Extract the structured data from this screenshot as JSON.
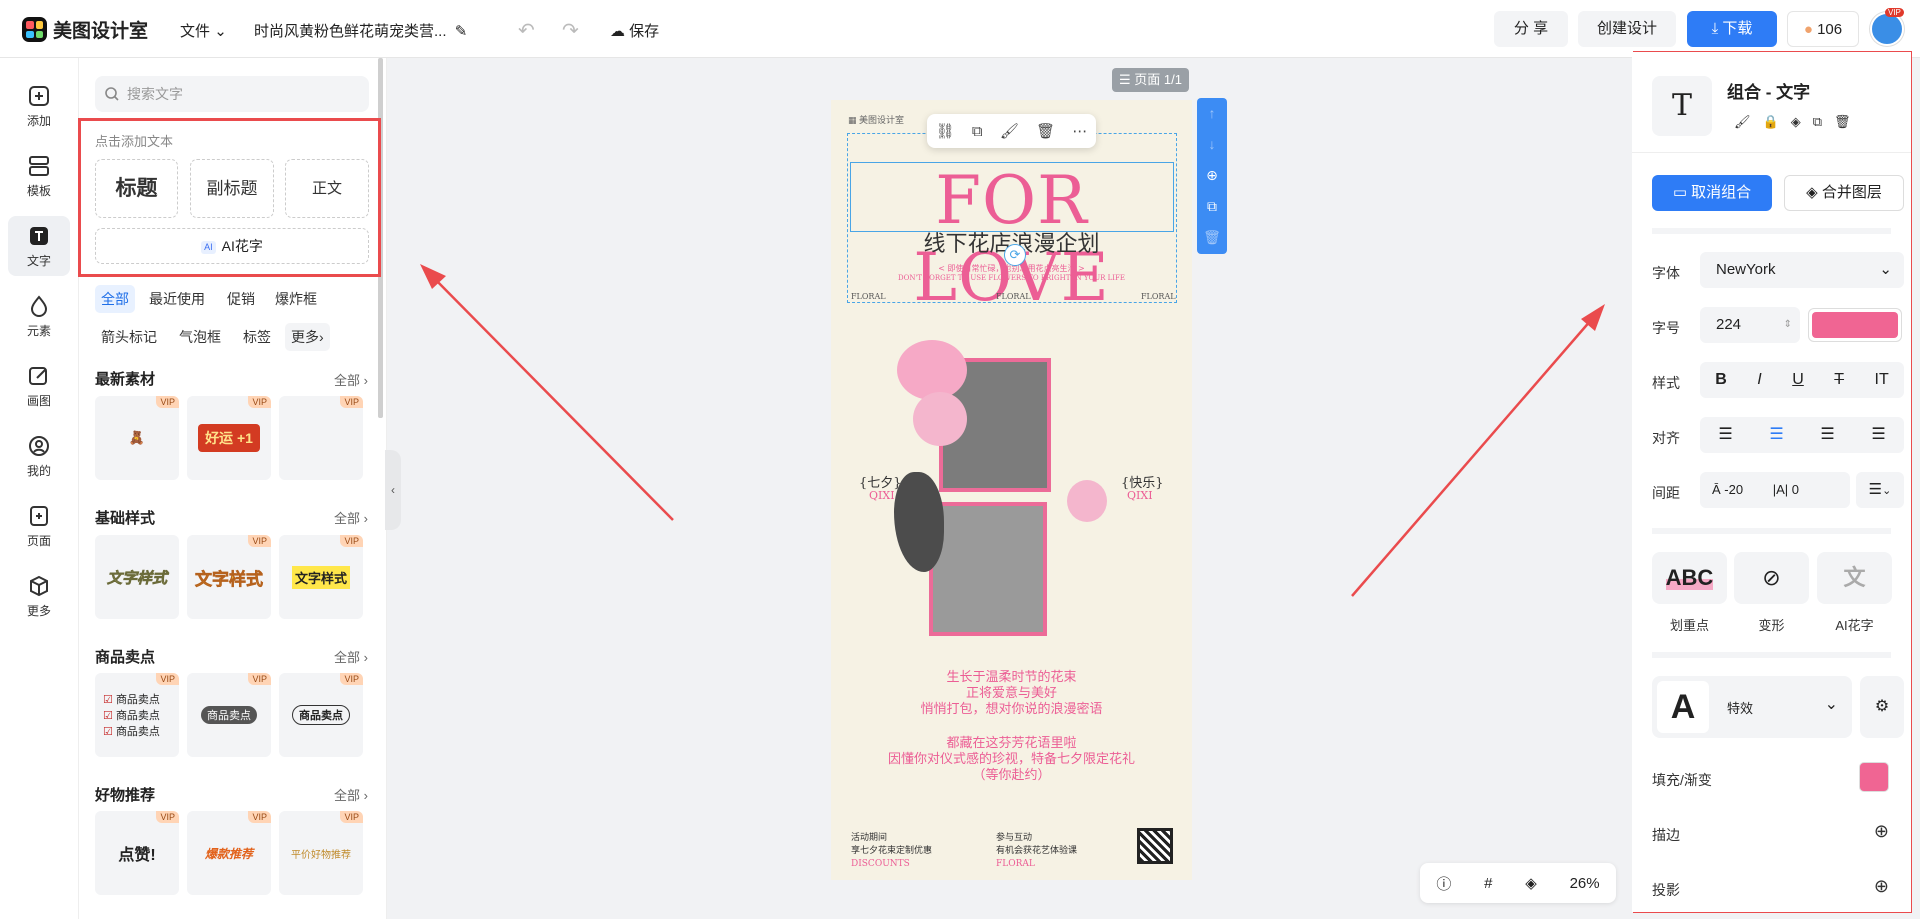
{
  "header": {
    "app_name": "美图设计室",
    "file_menu": "文件",
    "doc_title": "时尚风黄粉色鲜花萌宠类营...",
    "save": "保存",
    "share": "分 享",
    "create": "创建设计",
    "download": "下载",
    "points": "106",
    "vip": "VIP"
  },
  "rail": [
    {
      "label": "添加",
      "icon": "plus-square-icon"
    },
    {
      "label": "模板",
      "icon": "template-icon"
    },
    {
      "label": "文字",
      "icon": "text-icon"
    },
    {
      "label": "元素",
      "icon": "shapes-icon"
    },
    {
      "label": "画图",
      "icon": "draw-icon"
    },
    {
      "label": "我的",
      "icon": "user-icon"
    },
    {
      "label": "页面",
      "icon": "page-icon"
    },
    {
      "label": "更多",
      "icon": "box-icon"
    }
  ],
  "panel": {
    "search_placeholder": "搜索文字",
    "hint": "点击添加文本",
    "title_btn": "标题",
    "subtitle_btn": "副标题",
    "body_btn": "正文",
    "ai_btn": "AI花字",
    "ai_tag": "AI",
    "chips": [
      "全部",
      "最近使用",
      "促销",
      "爆炸框",
      "箭头标记",
      "气泡框",
      "标签",
      "更多"
    ],
    "sections": [
      {
        "title": "最新素材",
        "all": "全部",
        "tiles": [
          "",
          "好运 +1",
          ""
        ]
      },
      {
        "title": "基础样式",
        "all": "全部",
        "tiles": [
          "文字样式",
          "文字样式",
          "文字样式"
        ]
      },
      {
        "title": "商品卖点",
        "all": "全部",
        "tiles": [
          "商品卖点",
          "商品卖点",
          "商品卖点"
        ]
      },
      {
        "title": "好物推荐",
        "all": "全部",
        "tiles": [
          "点赞!",
          "爆款推荐",
          "平价好物推荐"
        ]
      }
    ]
  },
  "canvas": {
    "page_badge": "页面 1/1",
    "zoom": "26%"
  },
  "poster": {
    "brand": "美图设计室",
    "for_love": "FOR LOVE",
    "cn_title": "线下花店浪漫企划",
    "line1": "< 即使日常忙碌，也别忘用花点亮生活 >",
    "line2": "DON'T FORGET TO USE FLOWERS TO BRIGHTEN YOUR LIFE",
    "floral": "FLORAL",
    "qixi_cn": "{七夕}",
    "qixi_en": "QIXI",
    "kuaile_cn": "{快乐}",
    "body1": "生长于温柔时节的花束",
    "body2": "正将爱意与美好",
    "body3": "悄悄打包，想对你说的浪漫密语",
    "body4": "都藏在这芬芳花语里啦",
    "body5": "因懂你对仪式感的珍视，特备七夕限定花礼",
    "body6": "（等你赴约）",
    "foot1a": "活动期间",
    "foot1b": "享七夕花束定制优惠",
    "foot1c": "DISCOUNTS",
    "foot2a": "参与互动",
    "foot2b": "有机会获花艺体验课",
    "foot2c": "FLORAL"
  },
  "right": {
    "title": "组合 - 文字",
    "ungroup": "取消组合",
    "merge": "合并图层",
    "font_label": "字体",
    "font": "NewYork",
    "size_label": "字号",
    "size": "224",
    "color": "#f06593",
    "style_label": "样式",
    "align_label": "对齐",
    "spacing_label": "间距",
    "letter_spacing": "-20",
    "line_spacing": "0",
    "effects": [
      "划重点",
      "变形",
      "AI花字"
    ],
    "effect_label": "特效",
    "fill_label": "填充/渐变",
    "stroke_label": "描边",
    "shadow_label": "投影"
  }
}
